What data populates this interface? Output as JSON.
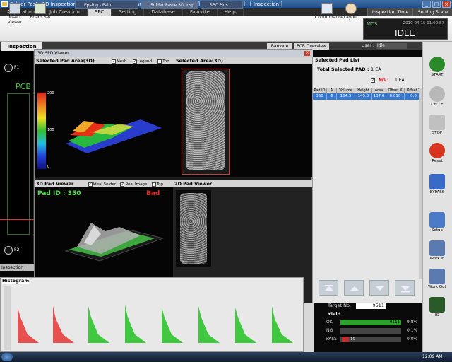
{
  "window": {
    "title": "Solder Paste 3D Inspection System - Koh Young Technology Inc. [ 5.5.0.0 P3 ] [ Job File Ver 1.0 ] - [ Inspection ]"
  },
  "menu": {
    "items": [
      "Application",
      "Job Creation",
      "SPC",
      "Setting",
      "Database",
      "Favorite",
      "Help"
    ],
    "active": 2,
    "right": [
      "Inspection Time",
      "Setting State"
    ]
  },
  "toolbar": {
    "left": [
      "Insert Viewer",
      "Board Set"
    ],
    "right": [
      "Conformance",
      "Layout"
    ]
  },
  "mcs": {
    "label": "MCS",
    "date": "2010-04-15 11:00:57",
    "state": "IDLE"
  },
  "tabs": {
    "main": "Inspection",
    "sub": [
      "Barcode",
      "PCB Overview"
    ],
    "user_label": "User :",
    "user_value": "Idle"
  },
  "pcb": {
    "label": "PCB",
    "fid_top": "F1",
    "fid_bottom": "F2"
  },
  "view3d": {
    "title": "3D SPD Viewer",
    "selected_pad_area": "Selected Pad Area(3D)",
    "mesh": "Mesh",
    "legend": "Legend",
    "top_view": "Top View",
    "selected_area": "Selected Area(3D)",
    "legend_ticks": [
      "200",
      "100",
      "0"
    ],
    "pad_viewer": "3D Pad Viewer",
    "ideal_solder": "Ideal Solder",
    "real_image": "Real Image",
    "pad_viewer_2d": "2D Pad Viewer",
    "pad_id": "Pad ID : 350",
    "status": "Bad"
  },
  "padlist": {
    "title": "Selected Pad List",
    "total_label": "Total Selected PAD :",
    "total_value": "1 EA",
    "ng_label": "NG :",
    "ng_value": "1 EA",
    "headers": [
      "Pad ID",
      "A",
      "Volume",
      "Height",
      "Area",
      "Offset X",
      "Offset Y"
    ],
    "row": [
      "350",
      "⚙",
      "164.5",
      "145.0",
      "137.6",
      "0.010",
      "0.0"
    ]
  },
  "sidebar": [
    "START",
    "CYCLE",
    "STOP",
    "Reset",
    "BYPASS",
    "Setup",
    "Work In",
    "Work Out",
    "IO"
  ],
  "bottom": {
    "insp_tab": "Inspection Pro...",
    "histogram": "Histogram",
    "target_label": "Target No.",
    "target_value": "9511",
    "yield_title": "Yield",
    "yield_rows": [
      {
        "name": "OK",
        "value": "9511",
        "pct": "9.8%"
      },
      {
        "name": "NG",
        "value": "",
        "pct": "0.1%"
      },
      {
        "name": "PASS",
        "value": "19",
        "pct": "0.0%"
      }
    ]
  },
  "taskbar": {
    "items": [
      "Start",
      "Epsing - Paint",
      "Solder Paste 3D Insp...",
      "SPC Plus"
    ],
    "clock": "12:09 AM"
  }
}
